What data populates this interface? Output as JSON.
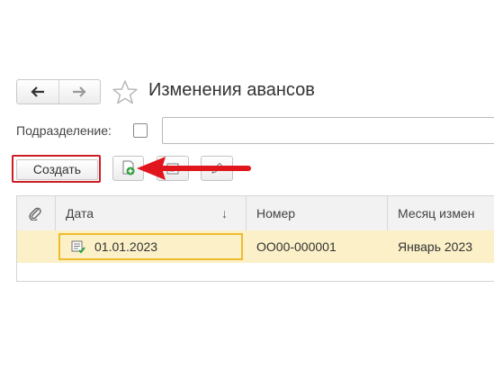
{
  "window": {
    "title": "Изменения авансов",
    "nav": {
      "back_icon": "arrow-left-icon",
      "forward_icon": "arrow-right-icon"
    },
    "favorite_icon": "star-icon"
  },
  "filter": {
    "label": "Подразделение:",
    "checkbox_checked": false,
    "input_value": ""
  },
  "toolbar": {
    "create_label": "Создать",
    "buttons": [
      {
        "icon": "copy-add-icon"
      },
      {
        "icon": "post-document-icon"
      },
      {
        "icon": "edit-pencil-icon"
      }
    ],
    "highlight_color": "#cc1f24",
    "arrow_color": "#e0161c"
  },
  "table": {
    "attachment_icon": "paperclip-icon",
    "columns": [
      "Дата",
      "Номер",
      "Месяц измен"
    ],
    "sort_indicator": "↓",
    "rows": [
      {
        "date": "01.01.2023",
        "number": "ОО00-000001",
        "month": "Январь 2023",
        "icon": "posted-document-icon"
      }
    ],
    "selected_row_color": "#fbf0c7",
    "focus_color": "#f0bb2b"
  }
}
